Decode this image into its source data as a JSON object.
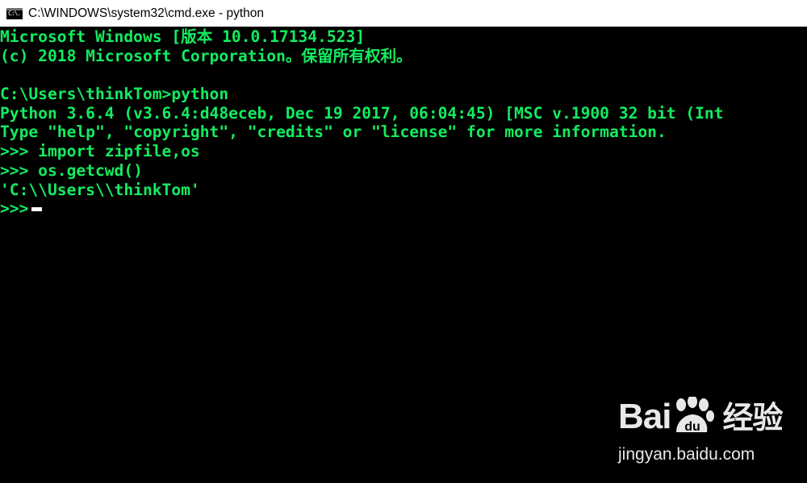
{
  "window": {
    "title": "C:\\WINDOWS\\system32\\cmd.exe - python",
    "icon": "cmd-console-icon",
    "icon_glyph": "C:\\."
  },
  "console": {
    "text_color": "#13ec60",
    "background": "#000000",
    "lines": [
      "Microsoft Windows [版本 10.0.17134.523]",
      "(c) 2018 Microsoft Corporation。保留所有权利。",
      "",
      "C:\\Users\\thinkTom>python",
      "Python 3.6.4 (v3.6.4:d48eceb, Dec 19 2017, 06:04:45) [MSC v.1900 32 bit (Int",
      "Type \"help\", \"copyright\", \"credits\" or \"license\" for more information.",
      ">>> import zipfile,os",
      ">>> os.getcwd()",
      "'C:\\\\Users\\\\thinkTom'",
      ">>>"
    ]
  },
  "watermark": {
    "logo_text_left": "Bai",
    "logo_text_right": "经验",
    "logo_text_du": "du",
    "url": "jingyan.baidu.com"
  }
}
